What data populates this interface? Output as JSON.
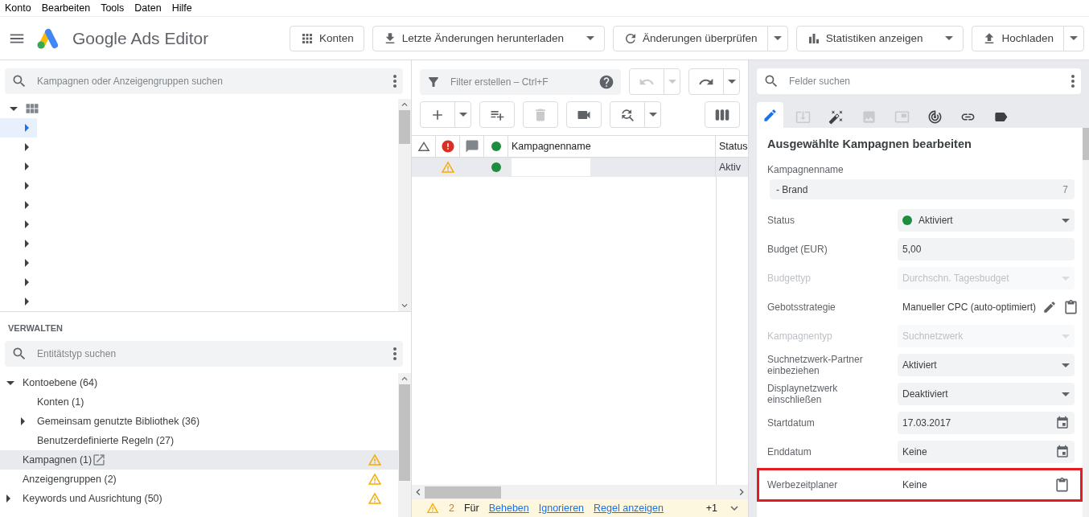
{
  "menu": [
    "Konto",
    "Bearbeiten",
    "Tools",
    "Daten",
    "Hilfe"
  ],
  "app_title": "Google Ads Editor",
  "header_buttons": [
    {
      "label": "Konten",
      "kind": "plain"
    },
    {
      "label": "Letzte Änderungen herunterladen",
      "kind": "dropdown"
    },
    {
      "label": "Änderungen überprüfen",
      "kind": "split"
    },
    {
      "label": "Statistiken anzeigen",
      "kind": "dropdown"
    },
    {
      "label": "Hochladen",
      "kind": "split"
    }
  ],
  "campaign_search": {
    "placeholder": "Kampagnen oder Anzeigengruppen suchen"
  },
  "account_tree": {
    "expanded": true,
    "rows": [
      {
        "selected": true
      },
      {
        "selected": false
      },
      {
        "selected": false
      },
      {
        "selected": false
      },
      {
        "selected": false
      },
      {
        "selected": false
      },
      {
        "selected": false
      },
      {
        "selected": false
      },
      {
        "selected": false
      },
      {
        "selected": false
      }
    ]
  },
  "manage": {
    "title": "VERWALTEN",
    "search": {
      "placeholder": "Entitätstyp suchen"
    },
    "items": [
      {
        "label": "Kontoebene (64)",
        "expanded": true,
        "selected": false,
        "children": [
          {
            "label": "Konten (1)",
            "selected": false
          },
          {
            "label": "Gemeinsam genutzte Bibliothek (36)",
            "expanded": false,
            "selected": false
          },
          {
            "label": "Benutzerdefinierte Regeln (27)",
            "selected": false
          }
        ]
      },
      {
        "label": "Kampagnen (1)",
        "selected": true,
        "warning": true,
        "external": true
      },
      {
        "label": "Anzeigengruppen (2)",
        "selected": false,
        "warning": true
      },
      {
        "label": "Keywords und Ausrichtung (50)",
        "expanded": false,
        "selected": false,
        "warning": true
      }
    ]
  },
  "filter": {
    "placeholder": "Filter erstellen – Ctrl+F"
  },
  "history_buttons": [
    {
      "disabled": true
    },
    {
      "disabled": false
    }
  ],
  "edit_toolbar": [
    {
      "disabled": false,
      "dropdown": true
    },
    {
      "disabled": false
    },
    {
      "disabled": true
    },
    {
      "disabled": false
    },
    {
      "disabled": false,
      "dropdown": true
    }
  ],
  "table": {
    "columns": [
      {
        "kind": "icon"
      },
      {
        "kind": "icon"
      },
      {
        "kind": "icon"
      },
      {
        "kind": "icon"
      },
      {
        "kind": "text",
        "label": "Kampagnenname"
      },
      {
        "kind": "text",
        "label": "Status"
      }
    ],
    "rows": [
      {
        "selected": true,
        "warning": true,
        "color": "#1e8e3e",
        "status": "Aktiv"
      }
    ]
  },
  "issues": {
    "count": "2",
    "text": "Für",
    "actions": [
      "Beheben",
      "Ignorieren",
      "Regel anzeigen"
    ],
    "more": "+1"
  },
  "field_search": {
    "placeholder": "Felder suchen"
  },
  "field_tabs": [
    {
      "selected": true,
      "disabled": false
    },
    {
      "selected": false,
      "disabled": true
    },
    {
      "selected": false,
      "disabled": false
    },
    {
      "selected": false,
      "disabled": true
    },
    {
      "selected": false,
      "disabled": true
    },
    {
      "selected": false,
      "disabled": false
    },
    {
      "selected": false,
      "disabled": false
    },
    {
      "selected": false,
      "disabled": false
    }
  ],
  "editor": {
    "title": "Ausgewählte Kampagnen bearbeiten",
    "fields": [
      {
        "kind": "text",
        "label": "Kampagnenname",
        "value": "- Brand",
        "count": "7"
      },
      {
        "kind": "status",
        "label": "Status",
        "value": "Aktiviert",
        "color": "#1e8e3e",
        "disabled": false
      },
      {
        "kind": "input",
        "label": "Budget (EUR)",
        "value": "5,00",
        "disabled": false
      },
      {
        "kind": "select",
        "label": "Budgettyp",
        "value": "Durchschn. Tagesbudget",
        "disabled": true
      },
      {
        "kind": "action",
        "label": "Gebotsstrategie",
        "value": "Manueller CPC (auto-optimiert)",
        "editable": true,
        "disabled": false
      },
      {
        "kind": "select",
        "label": "Kampagnentyp",
        "value": "Suchnetzwerk",
        "disabled": true
      },
      {
        "kind": "select",
        "label": "Suchnetzwerk-Partner einbeziehen",
        "value": "Aktiviert",
        "disabled": false
      },
      {
        "kind": "select",
        "label": "Displaynetzwerk einschließen",
        "value": "Deaktiviert",
        "disabled": false
      },
      {
        "kind": "date",
        "label": "Startdatum",
        "value": "17.03.2017",
        "disabled": false
      },
      {
        "kind": "date",
        "label": "Enddatum",
        "value": "Keine",
        "disabled": false
      },
      {
        "kind": "action",
        "label": "Werbezeitplaner",
        "value": "Keine",
        "editable": false,
        "disabled": false,
        "highlighted": true
      }
    ]
  }
}
